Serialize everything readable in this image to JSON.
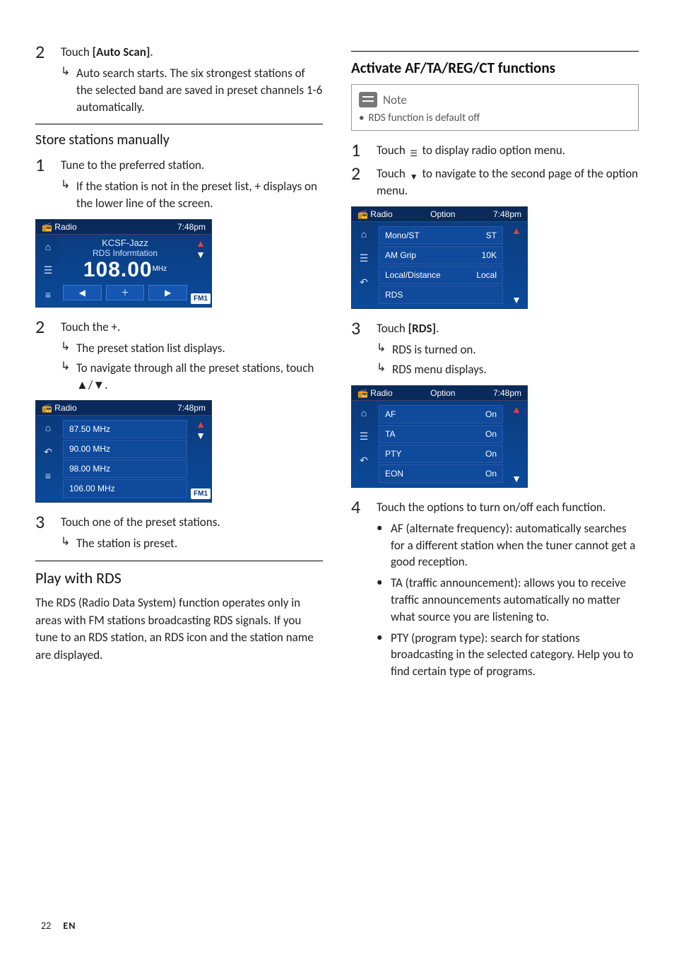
{
  "left": {
    "step2": {
      "prefix": "Touch ",
      "action": "[Auto Scan]",
      "suffix": ".",
      "sub": "Auto search starts. The six strongest stations of the selected band are saved in preset channels 1-6 automatically."
    },
    "store_head": "Store stations manually",
    "store_step1": {
      "text": "Tune to the preferred station.",
      "sub": "If the station is not in the preset list, + displays on the lower line of the screen."
    },
    "screenshot1": {
      "header_left": "Radio",
      "header_right": "7:48pm",
      "title": "KCSF-Jazz",
      "subtitle": "RDS Informtation",
      "freq": "108.00",
      "unit": "MHz",
      "band": "FM1"
    },
    "store_step2": {
      "text": "Touch the +.",
      "sub1": "The preset station list displays.",
      "sub2": "To navigate through all the preset stations, touch  ▲/▼."
    },
    "screenshot2": {
      "header_left": "Radio",
      "header_right": "7:48pm",
      "rows": [
        "87.50  MHz",
        "90.00  MHz",
        "98.00  MHz",
        "106.00 MHz"
      ],
      "band": "FM1"
    },
    "store_step3": {
      "text": "Touch one of the preset stations.",
      "sub": "The station is preset."
    },
    "rds_head": "Play with RDS",
    "rds_body": "The RDS (Radio Data System) function operates only in areas with FM stations broadcasting RDS signals. If you tune to an RDS station, an RDS icon and the station name are displayed."
  },
  "right": {
    "act_head": "Activate AF/TA/REG/CT functions",
    "note_label": "Note",
    "note_text": "RDS function is default off",
    "step1": {
      "pre": "Touch ",
      "post": " to display radio option menu."
    },
    "step2": {
      "pre": "Touch ",
      "post": " to navigate to the second page of the option menu."
    },
    "screenshot3": {
      "header_left": "Radio",
      "header_center": "Option",
      "header_right": "7:48pm",
      "rows": [
        {
          "l": "Mono/ST",
          "r": "ST"
        },
        {
          "l": "AM Grip",
          "r": "10K"
        },
        {
          "l": "Local/Distance",
          "r": "Local"
        },
        {
          "l": "RDS",
          "r": ""
        }
      ]
    },
    "step3": {
      "pre": "Touch ",
      "action": "[RDS]",
      "suffix": ".",
      "sub1": "RDS is turned on.",
      "sub2": "RDS menu displays."
    },
    "screenshot4": {
      "header_left": "Radio",
      "header_center": "Option",
      "header_right": "7:48pm",
      "rows": [
        {
          "l": "AF",
          "r": "On"
        },
        {
          "l": "TA",
          "r": "On"
        },
        {
          "l": "PTY",
          "r": "On"
        },
        {
          "l": "EON",
          "r": "On"
        }
      ]
    },
    "step4": {
      "text": "Touch the options to turn on/off each function.",
      "bullets": [
        "AF (alternate frequency): automatically searches for a different station when the tuner cannot get a good reception.",
        "TA (traffic announcement): allows you to receive traffic announcements automatically no matter what source you are listening to.",
        "PTY (program type): search for stations broadcasting in the selected category. Help you to find certain type of programs."
      ]
    }
  },
  "footer": {
    "page": "22",
    "lang": "EN"
  }
}
